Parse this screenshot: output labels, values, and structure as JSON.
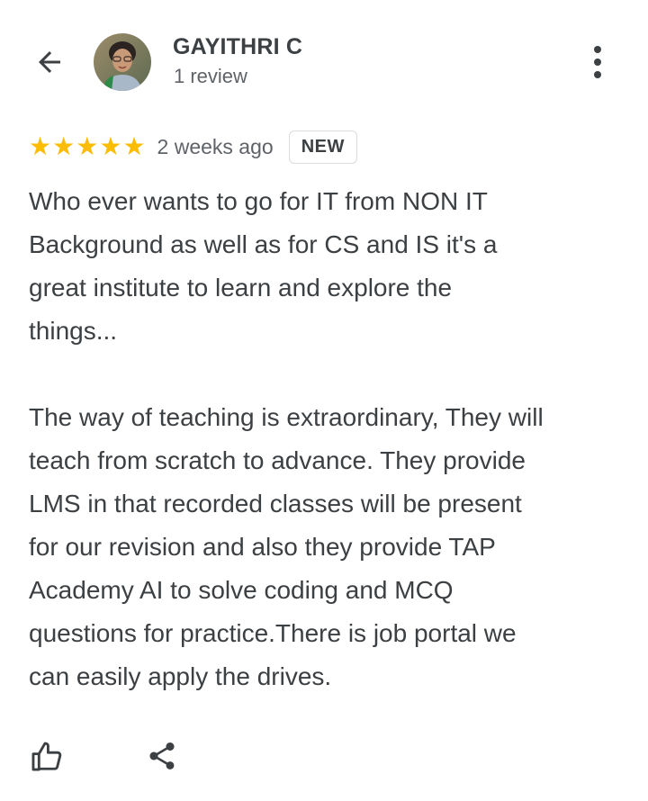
{
  "header": {
    "user_name": "GAYITHRI C",
    "review_count": "1 review",
    "back_icon": "arrow-back-icon",
    "more_icon": "more-vert-icon"
  },
  "review": {
    "rating": 5,
    "max_rating": 5,
    "star_color": "#fbbc04",
    "date": "2 weeks ago",
    "badge": "NEW",
    "paragraphs": [
      "Who ever wants to go for IT from NON IT\nBackground as well as for CS and IS it's a\ngreat institute to learn and explore the\nthings...",
      "The way of teaching is extraordinary, They will\nteach from scratch to advance. They provide\nLMS in that recorded classes will be present\nfor our revision and also they provide TAP\nAcademy AI to solve coding and MCQ\nquestions for practice.There is job portal we\ncan easily apply the drives."
    ]
  },
  "actions": {
    "like_icon": "thumbs-up-icon",
    "share_icon": "share-icon"
  }
}
